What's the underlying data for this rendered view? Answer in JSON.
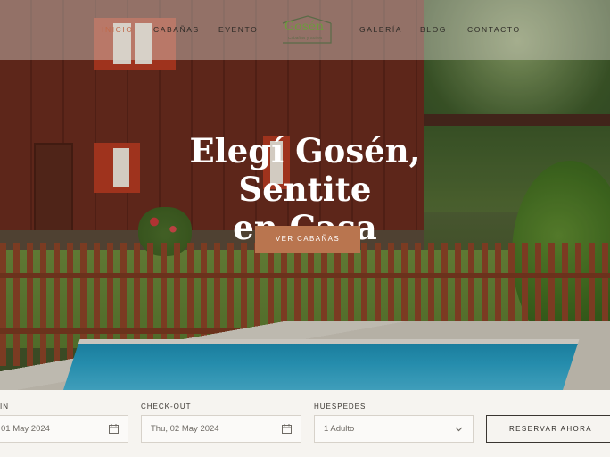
{
  "nav": {
    "left_items": [
      {
        "label": "INICIO",
        "active": true
      },
      {
        "label": "CABAÑAS",
        "active": false
      },
      {
        "label": "EVENTO",
        "active": false
      }
    ],
    "right_items": [
      {
        "label": "GALERÍA",
        "active": false
      },
      {
        "label": "BLOG",
        "active": false
      },
      {
        "label": "CONTACTO",
        "active": false
      }
    ],
    "logo": {
      "word": "Gosén",
      "subtitle": "Cabañas y Suites"
    }
  },
  "hero": {
    "title_line1": "Elegí Gosén, Sentite",
    "title_line2": "en Casa",
    "cta_label": "VER CABAÑAS"
  },
  "booking": {
    "checkin": {
      "label": "IN",
      "value": "01 May 2024",
      "icon": "calendar-icon"
    },
    "checkout": {
      "label": "CHECK-OUT",
      "value": "Thu, 02 May 2024",
      "icon": "calendar-icon"
    },
    "guests": {
      "label": "HUESPEDES:",
      "value": "1 Adulto",
      "icon": "chevron-down-icon"
    },
    "reserve_label": "RESERVAR AHORA"
  },
  "colors": {
    "accent": "#b9754f",
    "active_nav": "#c06a4a",
    "logo_green": "#6d9a3e",
    "text_dark": "#2d2a26"
  }
}
